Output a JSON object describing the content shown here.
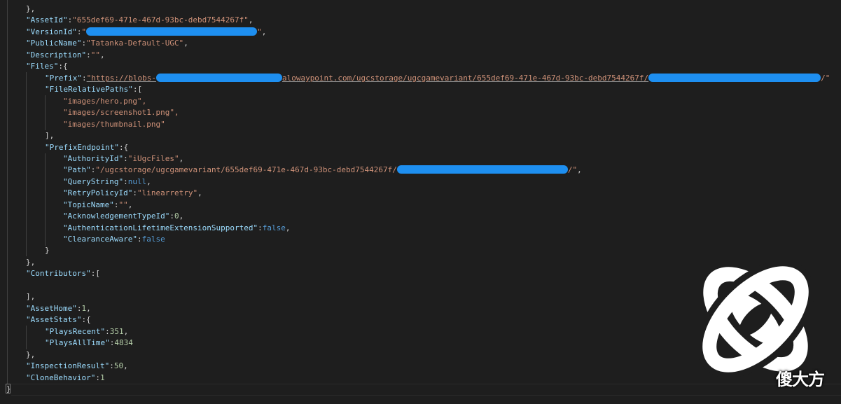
{
  "brand": {
    "watermark": "傻大方",
    "accent": "#1e8ff0"
  },
  "icons": [
    "halo-waypoint-logo"
  ],
  "json": {
    "close_brace_comma": "},",
    "asset_id_key": "\"AssetId\"",
    "asset_id_value": "\"655def69-471e-467d-93bc-debd7544267f\"",
    "version_id_key": "\"VersionId\"",
    "quote": "\"",
    "public_name_key": "\"PublicName\"",
    "public_name_value": "\"Tatanka-Default-UGC\"",
    "description_key": "\"Description\"",
    "description_value": "\"\"",
    "files_key": "\"Files\"",
    "prefix_key": "\"Prefix\"",
    "prefix_value_start": "\"https://blobs-",
    "prefix_value_mid": "alowaypoint.com/ugcstorage/ugcgamevariant/655def69-471e-467d-93bc-debd7544267f/",
    "prefix_value_end": "/\"",
    "file_relative_paths_key": "\"FileRelativePaths\"",
    "file_paths": [
      "\"images/hero.png\",",
      "\"images/screenshot1.png\",",
      "\"images/thumbnail.png\""
    ],
    "prefix_endpoint_key": "\"PrefixEndpoint\"",
    "authority_id_key": "\"AuthorityId\"",
    "authority_id_value": "\"iUgcFiles\"",
    "path_key": "\"Path\"",
    "path_value_start": "\"/ugcstorage/ugcgamevariant/655def69-471e-467d-93bc-debd7544267f/",
    "path_value_end": "/\"",
    "query_string_key": "\"QueryString\"",
    "null": "null",
    "retry_policy_id_key": "\"RetryPolicyId\"",
    "retry_policy_id_value": "\"linearretry\"",
    "topic_name_key": "\"TopicName\"",
    "topic_name_value": "\"\"",
    "acknowledgement_type_id_key": "\"AcknowledgementTypeId\"",
    "acknowledgement_type_id_value": "0",
    "auth_lifetime_key": "\"AuthenticationLifetimeExtensionSupported\"",
    "false": "false",
    "clearance_aware_key": "\"ClearanceAware\"",
    "contributors_key": "\"Contributors\"",
    "asset_home_key": "\"AssetHome\"",
    "asset_home_value": "1",
    "asset_stats_key": "\"AssetStats\"",
    "plays_recent_key": "\"PlaysRecent\"",
    "plays_recent_value": "351",
    "plays_all_time_key": "\"PlaysAllTime\"",
    "plays_all_time_value": "4834",
    "inspection_result_key": "\"InspectionResult\"",
    "inspection_result_value": "50",
    "clone_behavior_key": "\"CloneBehavior\"",
    "clone_behavior_value": "1",
    "final_brace": "}"
  }
}
